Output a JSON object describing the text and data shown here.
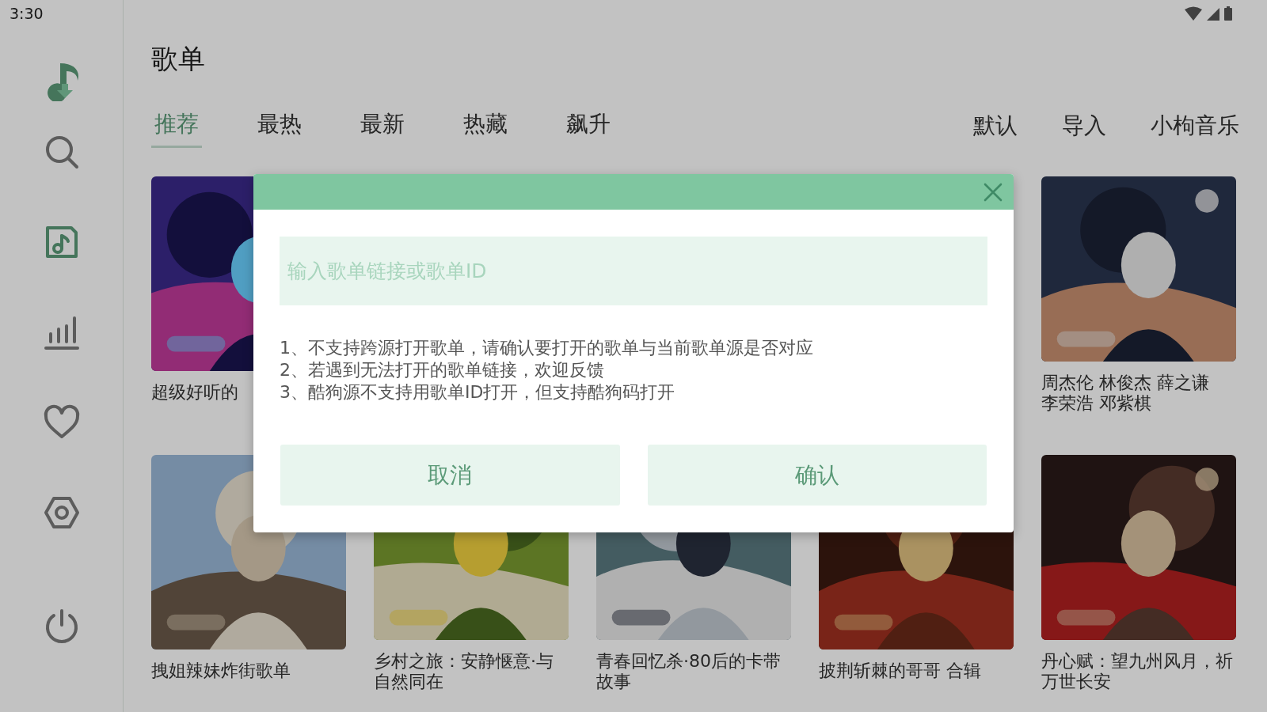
{
  "status_bar": {
    "time": "3:30"
  },
  "sidebar": {
    "items": [
      {
        "kind": "search",
        "selected": false
      },
      {
        "kind": "playlist",
        "selected": true
      },
      {
        "kind": "chart",
        "selected": false
      },
      {
        "kind": "heart",
        "selected": false
      },
      {
        "kind": "settings",
        "selected": false
      },
      {
        "kind": "power",
        "selected": false
      }
    ]
  },
  "page_title": "歌单",
  "tabs": [
    {
      "label": "推荐",
      "selected": true
    },
    {
      "label": "最热",
      "selected": false
    },
    {
      "label": "最新",
      "selected": false
    },
    {
      "label": "热藏",
      "selected": false
    },
    {
      "label": "飙升",
      "selected": false
    }
  ],
  "source_actions": [
    "默认",
    "导入",
    "小枸音乐"
  ],
  "playlists": [
    {
      "title": "超级好听的",
      "kind": "picture"
    },
    {
      "kind": "hidden"
    },
    {
      "kind": "hidden"
    },
    {
      "kind": "hidden"
    },
    {
      "title": "周杰伦 林俊杰 薛之谦李荣浩 邓紫棋",
      "kind": "picture"
    },
    {
      "title": "拽姐辣妹炸街歌单",
      "kind": "picture"
    },
    {
      "title": "乡村之旅：安静惬意·与自然同在",
      "kind": "picture"
    },
    {
      "title": "青春回忆杀·80后的卡带故事",
      "kind": "picture"
    },
    {
      "title": "披荆斩棘的哥哥 合辑",
      "kind": "picture"
    },
    {
      "title": "丹心赋：望九州风月，祈万世长安",
      "kind": "picture"
    }
  ],
  "dialog": {
    "input": {
      "placeholder": "输入歌单链接或歌单ID"
    },
    "notes": [
      "1、不支持跨源打开歌单，请确认要打开的歌单与当前歌单源是否对应",
      "2、若遇到无法打开的歌单链接，欢迎反馈",
      "3、酷狗源不支持用歌单ID打开，但支持酷狗码打开"
    ],
    "buttons": [
      "取消",
      "确认"
    ]
  }
}
